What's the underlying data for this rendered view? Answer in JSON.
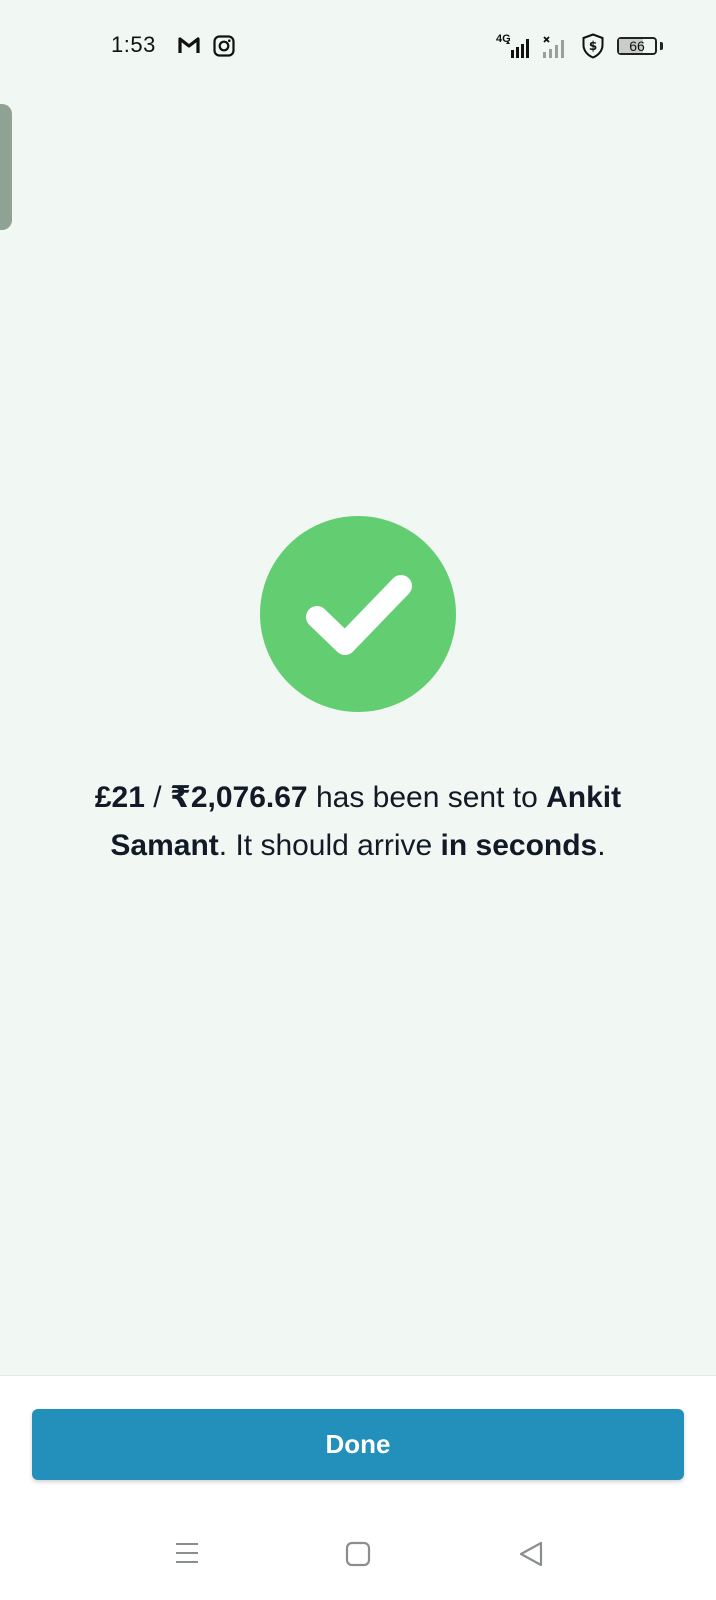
{
  "status_bar": {
    "time": "1:53",
    "network_type": "4G",
    "battery_level": "66",
    "battery_fraction": 0.66,
    "icons": [
      "gmail-icon",
      "instagram-icon",
      "signal-4g-icon",
      "signal-no-service-icon",
      "vpn-dollar-icon",
      "battery-icon"
    ]
  },
  "confirmation": {
    "amount_gbp": "£21",
    "separator": " / ",
    "amount_inr": "₹2,076.67",
    "sent_text": " has been sent to ",
    "recipient": "Ankit Samant",
    "period1": ". ",
    "arrival_text": "It should arrive ",
    "arrival_time": "in seconds",
    "period2": "."
  },
  "footer": {
    "done_label": "Done"
  },
  "nav_bar": {
    "icons": [
      "menu-icon",
      "home-icon",
      "back-icon"
    ]
  },
  "colors": {
    "background": "#f1f7f3",
    "success_green": "#63cd72",
    "button_blue": "#238fbb",
    "text_dark": "#111a26"
  }
}
